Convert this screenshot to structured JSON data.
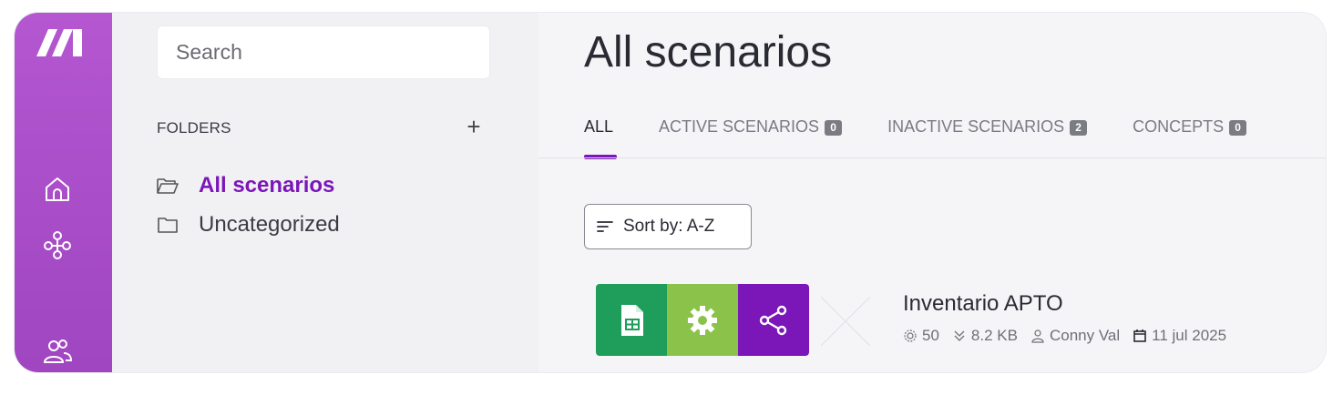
{
  "sidebar": {
    "logo_icon": "make-logo-icon",
    "nav_icons": [
      "home-icon",
      "scenarios-icon",
      "team-icon"
    ],
    "colors": {
      "rail": "#b457d1",
      "accent": "#7b16b8"
    }
  },
  "folder_panel": {
    "search_placeholder": "Search",
    "folders_title": "FOLDERS",
    "add_label": "+",
    "folders": [
      {
        "label": "All scenarios",
        "icon": "folder-open-icon",
        "active": true
      },
      {
        "label": "Uncategorized",
        "icon": "folder-icon",
        "active": false
      }
    ]
  },
  "main": {
    "title": "All scenarios",
    "tabs": [
      {
        "label": "ALL",
        "count": null,
        "active": true
      },
      {
        "label": "ACTIVE SCENARIOS",
        "count": "0",
        "active": false
      },
      {
        "label": "INACTIVE SCENARIOS",
        "count": "2",
        "active": false
      },
      {
        "label": "CONCEPTS",
        "count": "0",
        "active": false
      }
    ],
    "sort_label": "Sort by: A-Z",
    "scenario": {
      "name": "Inventario APTO",
      "apps": [
        {
          "icon": "google-sheets-icon",
          "color": "#1e9e5a"
        },
        {
          "icon": "tools-gear-icon",
          "color": "#8bc34a"
        },
        {
          "icon": "share-icon",
          "color": "#7b16b8"
        }
      ],
      "operations": "50",
      "data_size": "8.2 KB",
      "owner": "Conny Val",
      "date": "11 jul 2025"
    }
  }
}
